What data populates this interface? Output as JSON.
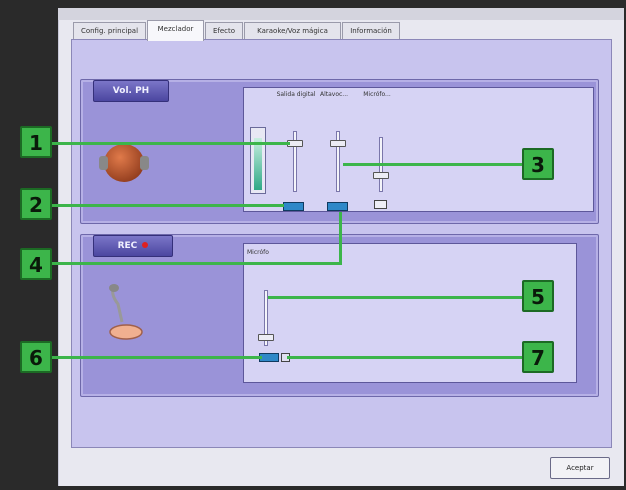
{
  "tabs": [
    {
      "label": "Config. principal"
    },
    {
      "label": "Mezclador"
    },
    {
      "label": "Efecto"
    },
    {
      "label": "Karaoke/Voz mágica"
    },
    {
      "label": "Información"
    }
  ],
  "playback": {
    "header": "Vol. PH",
    "columns": [
      "Salida digital",
      "Altavoc...",
      "Micrófo..."
    ]
  },
  "record": {
    "header": "REC",
    "label": "Micrófo"
  },
  "callouts": [
    "1",
    "2",
    "3",
    "4",
    "5",
    "6",
    "7"
  ],
  "ok_button": "Aceptar",
  "colors": {
    "callout": "#3cb54a",
    "panel": "#9a93d8"
  }
}
